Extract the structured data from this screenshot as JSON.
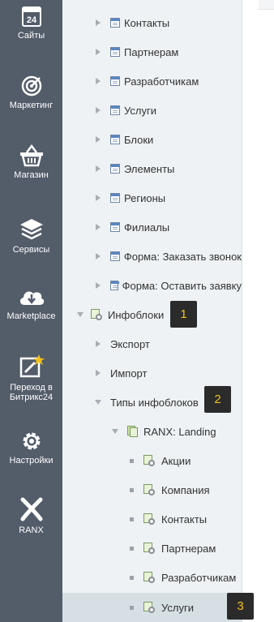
{
  "rail": {
    "items": [
      {
        "label": "Сайты",
        "icon": "sites-24-icon"
      },
      {
        "label": "Маркетинг",
        "icon": "target-icon"
      },
      {
        "label": "Магазин",
        "icon": "basket-icon"
      },
      {
        "label": "Сервисы",
        "icon": "layers-icon"
      },
      {
        "label": "Marketplace",
        "icon": "cloud-download-icon"
      },
      {
        "label_line1": "Переход в",
        "label_line2": "Битрикс24",
        "icon": "edit-star-icon"
      },
      {
        "label": "Настройки",
        "icon": "gear-icon"
      },
      {
        "label": "RANX",
        "icon": "ranx-logo-icon"
      }
    ]
  },
  "tree": {
    "sections": [
      "Контакты",
      "Партнерам",
      "Разработчикам",
      "Услуги",
      "Блоки",
      "Элементы",
      "Регионы",
      "Филиалы",
      "Форма: Заказать звонок",
      "Форма: Оставить заявку"
    ],
    "iblocks": "Инфоблоки",
    "export": "Экспорт",
    "import": "Импорт",
    "iblock_types": "Типы инфоблоков",
    "ranx_type": "RANX: Landing",
    "ranx_children": [
      "Акции",
      "Компания",
      "Контакты",
      "Партнерам",
      "Разработчикам",
      "Услуги"
    ]
  },
  "badges": [
    "1",
    "2",
    "3"
  ],
  "colors": {
    "rail_bg": "#535c69",
    "panel_bg": "#eef2f4",
    "badge_bg": "#2b2b2b",
    "badge_text": "#f2c21b"
  }
}
